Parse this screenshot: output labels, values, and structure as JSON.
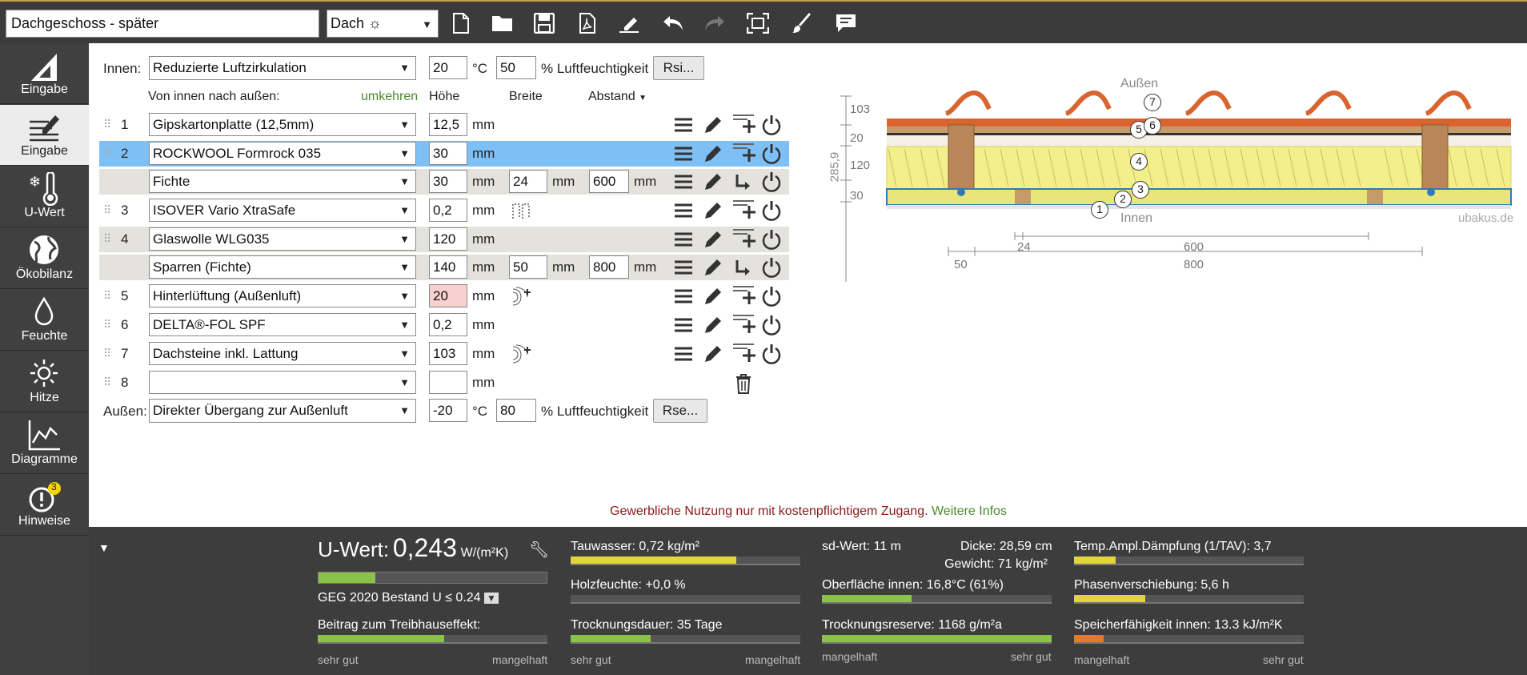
{
  "header": {
    "title_value": "Dachgeschoss - später",
    "type_select": "Dach ☼"
  },
  "toolbar": [
    "new-document-icon",
    "open-folder-icon",
    "save-icon",
    "pdf-icon",
    "edit-signature-icon",
    "undo-icon",
    "redo-icon",
    "fit-screen-icon",
    "brush-icon",
    "comment-icon"
  ],
  "nav": [
    {
      "id": "eingabe-ruler",
      "label": "Eingabe",
      "icon": "ruler-icon"
    },
    {
      "id": "eingabe",
      "label": "Eingabe",
      "icon": "layers-edit-icon"
    },
    {
      "id": "u-wert",
      "label": "U-Wert",
      "icon": "thermometer-icon"
    },
    {
      "id": "oekobilanz",
      "label": "Ökobilanz",
      "icon": "globe-icon"
    },
    {
      "id": "feuchte",
      "label": "Feuchte",
      "icon": "drop-icon"
    },
    {
      "id": "hitze",
      "label": "Hitze",
      "icon": "sun-icon"
    },
    {
      "id": "diagramme",
      "label": "Diagramme",
      "icon": "chart-icon"
    },
    {
      "id": "hinweise",
      "label": "Hinweise",
      "icon": "warning-icon",
      "badge": "3"
    }
  ],
  "form": {
    "inner_label": "Innen:",
    "inner_select": "Reduzierte Luftzirkulation",
    "inner_temp": "20",
    "inner_temp_unit": "°C",
    "inner_hum": "50",
    "inner_hum_unit": "% Luftfeuchtigkeit",
    "rsi": "Rsi...",
    "direction": "Von innen nach außen:",
    "reverse": "umkehren",
    "col_height": "Höhe",
    "col_width": "Breite",
    "col_spacing": "Abstand",
    "outer_label": "Außen:",
    "outer_select": "Direkter Übergang zur Außenluft",
    "outer_temp": "-20",
    "outer_temp_unit": "°C",
    "outer_hum": "80",
    "outer_hum_unit": "% Luftfeuchtigkeit",
    "rse": "Rse...",
    "mm": "mm"
  },
  "layers": [
    {
      "num": "1",
      "name": "Gipskartonplatte (12,5mm)",
      "height": "12,5"
    },
    {
      "num": "2",
      "name": "ROCKWOOL Formrock 035",
      "height": "30",
      "selected": true
    },
    {
      "num": "",
      "name": "Fichte",
      "height": "30",
      "width": "24",
      "spacing": "600",
      "sub": true
    },
    {
      "num": "3",
      "name": "ISOVER Vario XtraSafe",
      "height": "0,2"
    },
    {
      "num": "4",
      "name": "Glaswolle WLG035",
      "height": "120"
    },
    {
      "num": "",
      "name": "Sparren (Fichte)",
      "height": "140",
      "width": "50",
      "spacing": "800",
      "sub": true
    },
    {
      "num": "5",
      "name": "Hinterlüftung (Außenluft)",
      "height": "20",
      "warn": true
    },
    {
      "num": "6",
      "name": "DELTA®-FOL SPF",
      "height": "0,2"
    },
    {
      "num": "7",
      "name": "Dachsteine inkl. Lattung",
      "height": "103"
    },
    {
      "num": "8",
      "name": "",
      "height": ""
    }
  ],
  "drawing": {
    "outside": "Außen",
    "inside": "Innen",
    "credit": "ubakus.de",
    "total": "285,9",
    "dims": [
      "103",
      "20",
      "120",
      "30"
    ],
    "w24": "24",
    "w600": "600",
    "w50": "50",
    "w800": "800",
    "markers": [
      "1",
      "2",
      "3",
      "4",
      "5",
      "6",
      "7"
    ]
  },
  "notice": {
    "text": "Gewerbliche Nutzung nur mit kostenpflichtigem Zugang.",
    "link": "Weitere Infos"
  },
  "results": {
    "uwert_label": "U-Wert:",
    "uwert_value": "0,243",
    "uwert_unit": "W/(m²K)",
    "uwert_fill": 0.25,
    "geg": "GEG 2020 Bestand U ≤ 0.24",
    "treib": "Beitrag zum Treibhauseffekt:",
    "treib_fill": 0.55,
    "good": "sehr gut",
    "bad": "mangelhaft",
    "tauwasser": "Tauwasser: 0,72 kg/m²",
    "tauwasser_fill": 0.72,
    "holz": "Holzfeuchte: +0,0 %",
    "holz_fill": 0.0,
    "trocknung": "Trocknungsdauer: 35 Tage",
    "trocknung_fill": 0.35,
    "sd": "sd-Wert: 11 m",
    "dicke": "Dicke: 28,59 cm",
    "gewicht": "Gewicht: 71 kg/m²",
    "oberflaeche": "Oberfläche innen: 16,8°C (61%)",
    "oberflaeche_fill": 0.39,
    "reserve": "Trocknungsreserve: 1168 g/m²a",
    "reserve_fill": 1.0,
    "tav": "Temp.Ampl.Dämpfung (1/TAV): 3,7",
    "tav_fill": 0.18,
    "phase": "Phasenverschiebung: 5,6 h",
    "phase_fill": 0.31,
    "speicher": "Speicherfähigkeit innen: 13.3 kJ/m²K",
    "speicher_fill": 0.13
  }
}
